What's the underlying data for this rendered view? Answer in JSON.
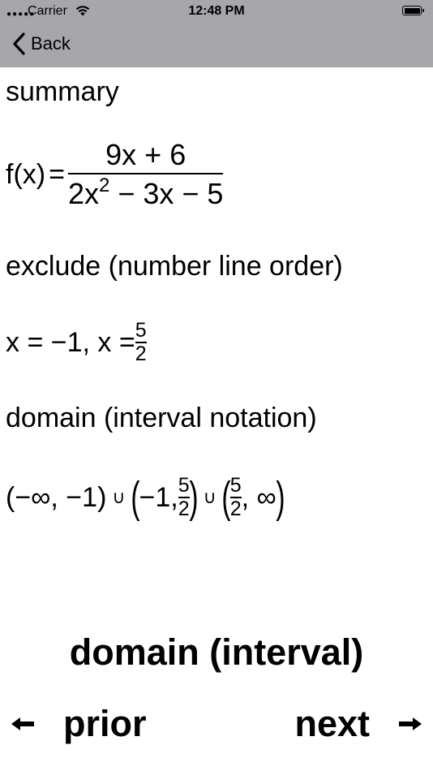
{
  "status_bar": {
    "carrier": "Carrier",
    "time": "12:48 PM"
  },
  "nav": {
    "back_label": "Back"
  },
  "summary": {
    "heading": "summary",
    "function_lhs": "f(x)",
    "equals": "=",
    "numerator": "9x + 6",
    "denominator_a": "2x",
    "denominator_exp": "2",
    "denominator_b": " − 3x − 5"
  },
  "exclude": {
    "heading": "exclude (number line order)",
    "text": "x = −1, x = ",
    "frac_num": "5",
    "frac_den": "2"
  },
  "domain": {
    "heading": "domain (interval notation)",
    "part1": "(−∞, −1)",
    "union": "∪",
    "part2_open": "(",
    "part2_text": "−1, ",
    "frac_num": "5",
    "frac_den": "2",
    "part2_close": ")",
    "part3_open": "(",
    "part3_frac_num": "5",
    "part3_frac_den": "2",
    "part3_text": ", ∞",
    "part3_close": ")"
  },
  "footer": {
    "title": "domain (interval)",
    "prior_label": "prior",
    "next_label": "next",
    "prior_icon": "arrow-left-icon",
    "next_icon": "arrow-right-icon"
  },
  "colors": {
    "nav_background": "#a7a7ab",
    "background": "#ffffff",
    "text": "#000000"
  }
}
